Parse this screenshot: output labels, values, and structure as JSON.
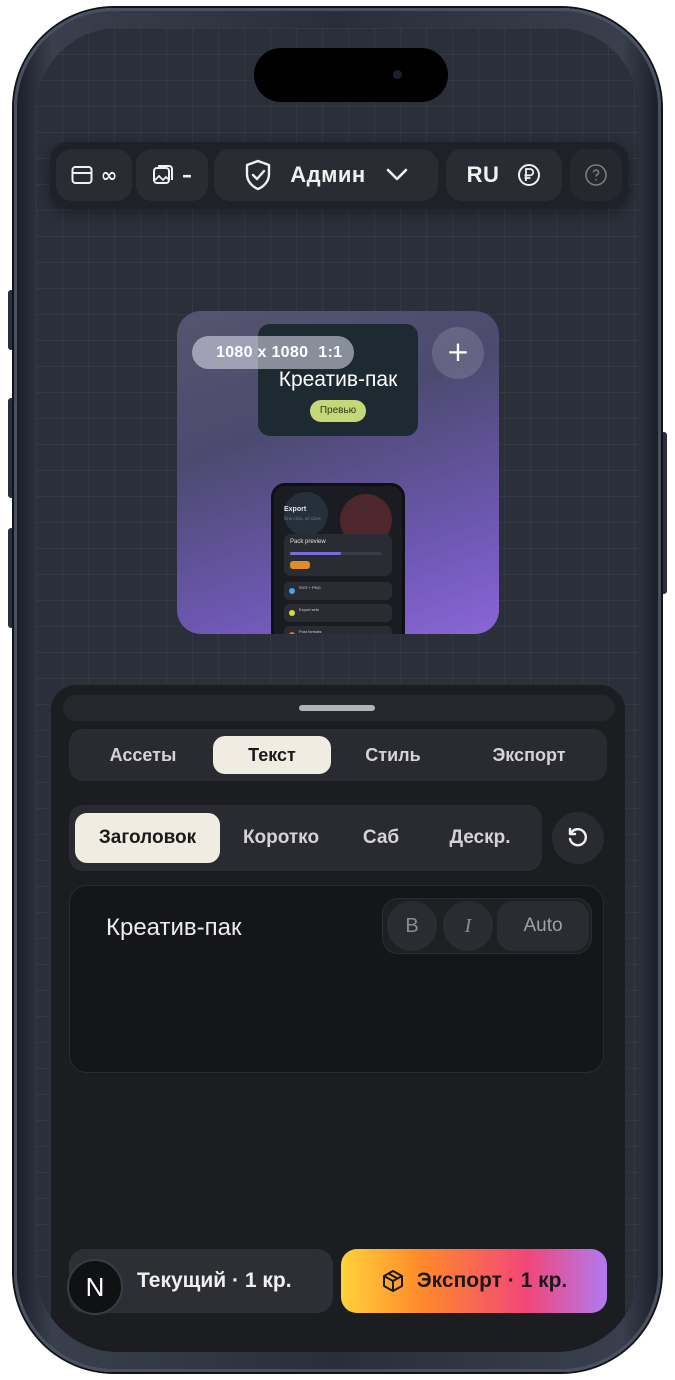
{
  "toolbar": {
    "panel_infinity": "∞",
    "image_minus": "–",
    "role_label": "Админ",
    "language": "RU"
  },
  "preview": {
    "size_label": "1080 x 1080",
    "ratio_label": "1:1",
    "card_title": "Креатив-пак",
    "card_badge": "Превью",
    "add_symbol": "+",
    "mini_phone": {
      "title": "Export",
      "subtitle": "One click, all sizes",
      "card_label": "Pack preview",
      "progress": 0.55,
      "rows": [
        "SVG + PNG",
        "Export sets",
        "Post formats"
      ]
    }
  },
  "tabs": [
    {
      "label": "Ассеты"
    },
    {
      "label": "Текст"
    },
    {
      "label": "Стиль"
    },
    {
      "label": "Экспорт"
    }
  ],
  "active_tab": "Текст",
  "subtabs": [
    {
      "label": "Заголовок"
    },
    {
      "label": "Коротко"
    },
    {
      "label": "Саб"
    },
    {
      "label": "Дескр."
    }
  ],
  "active_subtab": "Заголовок",
  "editor": {
    "text": "Креатив-пак",
    "bold_label": "B",
    "italic_label": "I",
    "auto_label": "Auto"
  },
  "footer": {
    "current_label": "Текущий · 1 кр.",
    "export_label": "Экспорт · 1 кр.",
    "badge_letter": "N"
  },
  "icons": [
    "panel-icon",
    "image-icon",
    "shield-icon",
    "chevron-down-icon",
    "ruble-icon",
    "help-icon",
    "reset-icon",
    "box-icon"
  ],
  "colors": {
    "active_tab_bg": "#f1ece2",
    "sheet_bg": "#1c1d21",
    "export_gradient": [
      "#ffd23a",
      "#ff8a2a",
      "#f2467a",
      "#b07af0"
    ]
  }
}
